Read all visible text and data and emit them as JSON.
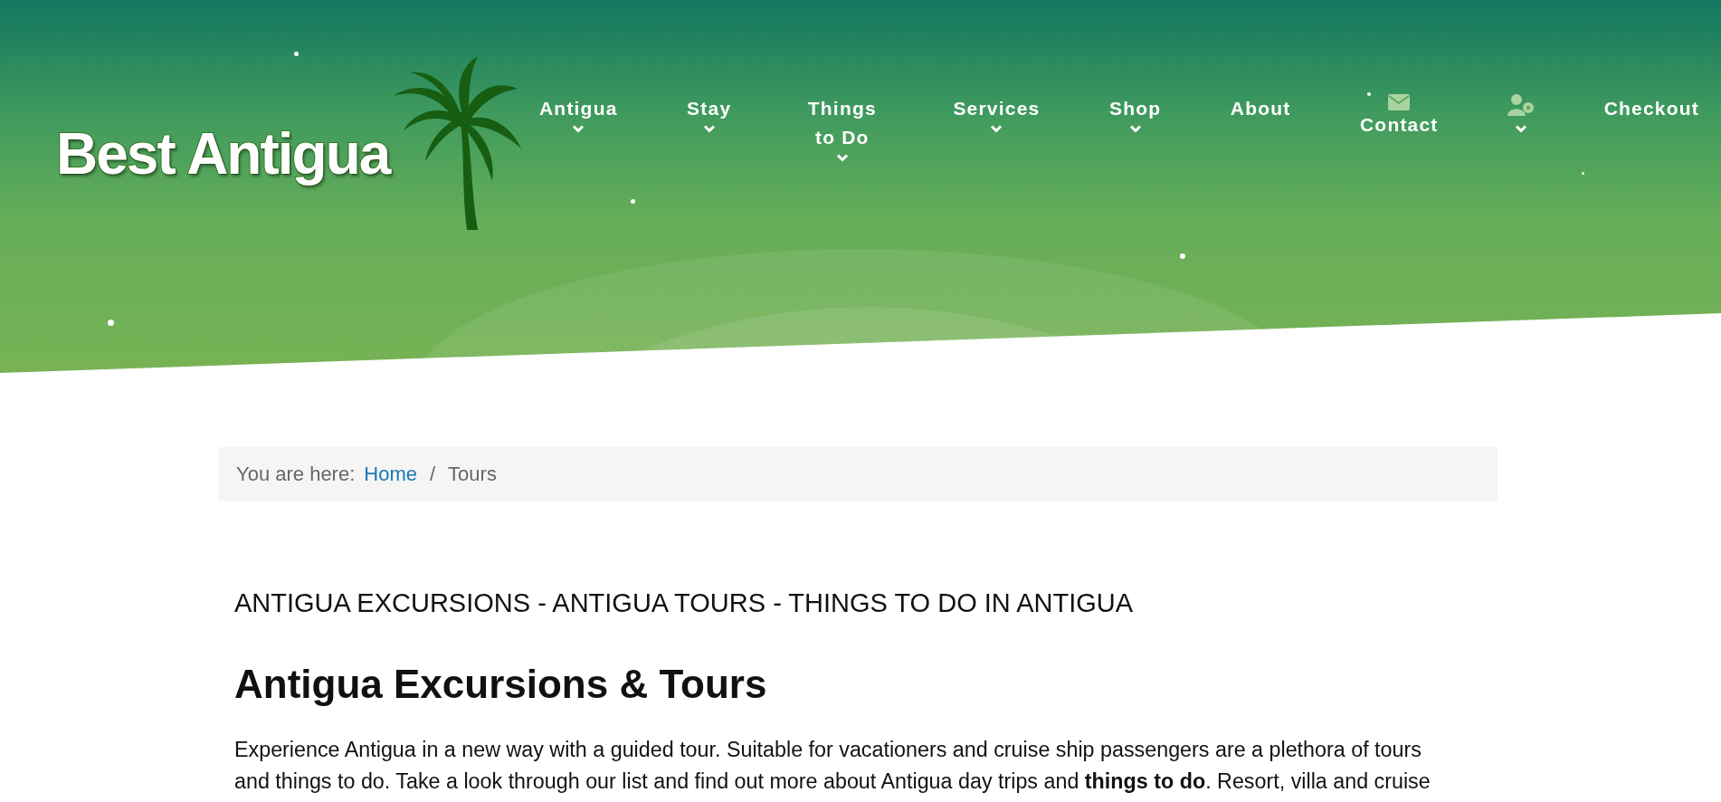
{
  "site": {
    "logo": "Best Antigua"
  },
  "nav": [
    {
      "kind": "link",
      "label": "Antigua",
      "dropdown": true
    },
    {
      "kind": "link",
      "label": "Stay",
      "dropdown": true
    },
    {
      "kind": "link",
      "label": "Things to Do",
      "dropdown": true
    },
    {
      "kind": "link",
      "label": "Services",
      "dropdown": true
    },
    {
      "kind": "link",
      "label": "Shop",
      "dropdown": true
    },
    {
      "kind": "link",
      "label": "About",
      "dropdown": false
    },
    {
      "kind": "mail",
      "label": "Contact",
      "dropdown": false
    },
    {
      "kind": "account",
      "dropdown": true
    },
    {
      "kind": "link",
      "label": "Checkout",
      "dropdown": false
    }
  ],
  "breadcrumb": {
    "label": "You are here:",
    "separator": "/",
    "items": [
      {
        "text": "Home",
        "link": true
      },
      {
        "text": "Tours",
        "link": false
      }
    ]
  },
  "subtitle": "ANTIGUA EXCURSIONS - ANTIGUA TOURS - THINGS TO DO IN ANTIGUA",
  "heading": "Antigua Excursions & Tours",
  "intro": "Experience Antigua in a new way with a guided tour. Suitable for vacationers and cruise ship passengers are a plethora of tours\nand things to do. Take a look through our list and find out more about Antigua day trips and **things to do**. Resort, villa and cruise"
}
